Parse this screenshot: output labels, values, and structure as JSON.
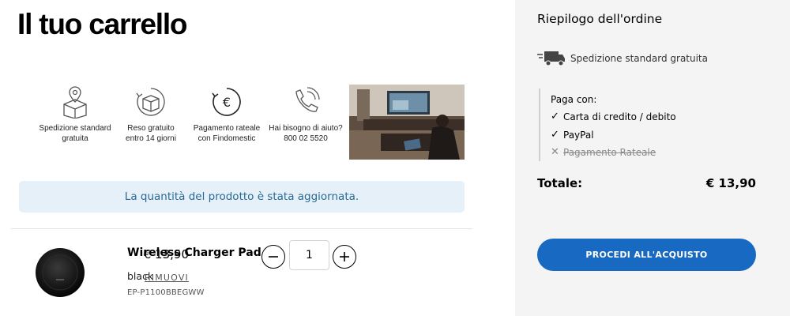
{
  "cart": {
    "title": "Il tuo carrello",
    "benefits": [
      {
        "icon": "box-pin-icon",
        "text": "Spedizione standard\ngratuita"
      },
      {
        "icon": "box-return-icon",
        "text": "Reso gratuito\nentro 14 giorni"
      },
      {
        "icon": "euro-cycle-icon",
        "text": "Pagamento rateale\ncon Findomestic"
      },
      {
        "icon": "phone-icon",
        "text": "Hai bisogno di aiuto?\n800 02 5520"
      }
    ],
    "notice": "La quantità del prodotto è stata aggiornata.",
    "item": {
      "name": "Wireless Charger Pad",
      "variant": "black",
      "sku": "EP-P1100BBEGWW",
      "quantity": "1",
      "price": "€ 13,90",
      "remove_label": "RIMUOVI"
    }
  },
  "summary": {
    "title": "Riepilogo dell'ordine",
    "shipping": "Spedizione standard gratuita",
    "payment_label": "Paga con:",
    "payment_methods": [
      {
        "label": "Carta di credito / debito",
        "available": true
      },
      {
        "label": "PayPal",
        "available": true
      },
      {
        "label": "Pagamento Rateale",
        "available": false
      }
    ],
    "total_label": "Totale:",
    "total_value": "€ 13,90",
    "checkout_label": "PROCEDI ALL'ACQUISTO"
  },
  "colors": {
    "accent": "#1769c2",
    "notice_bg": "#e5f0f8",
    "notice_text": "#2a6a95",
    "summary_bg": "#f4f4f4"
  }
}
